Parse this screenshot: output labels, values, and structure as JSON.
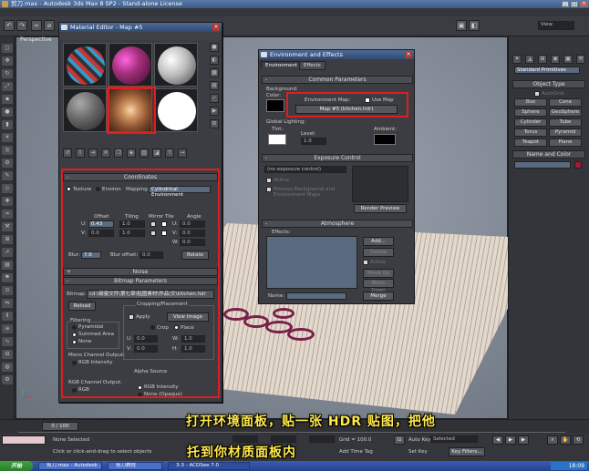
{
  "window": {
    "title": "剪刀.max - Autodesk 3ds Max 8 SP2 - Stand-alone License",
    "view_dropdown": "View"
  },
  "viewport": {
    "label": "Perspective"
  },
  "material_editor": {
    "title": "Material Editor - Map #5",
    "coordinates_rollup": {
      "title": "Coordinates",
      "texture_label": "Texture",
      "environ_label": "Environ",
      "mapping_label": "Mapping:",
      "mapping_value": "Cylindrical Environment",
      "offset_label": "Offset",
      "tiling_label": "Tiling",
      "mirror_tile_label": "Mirror Tile",
      "angle_label": "Angle",
      "u_label": "U:",
      "v_label": "V:",
      "w_label": "W:",
      "u_offset": "0.43",
      "u_tiling": "1.0",
      "u_angle": "0.0",
      "v_offset": "0.0",
      "v_tiling": "1.0",
      "v_angle": "0.0",
      "w_angle": "0.0",
      "blur_label": "Blur:",
      "blur_value": "7.0",
      "blur_offset_label": "Blur offset:",
      "blur_offset_value": "0.0",
      "rotate_label": "Rotate"
    },
    "noise_rollup": {
      "title": "Noise"
    },
    "bitmap_rollup": {
      "title": "Bitmap Parameters",
      "bitmap_label": "Bitmap:",
      "bitmap_path": "cd:\\碳曼文件\\第七章\\贴图素材\\作品\\文\\kitchen.hdr",
      "reload_label": "Reload",
      "cropping_title": "Cropping/Placement",
      "apply_label": "Apply",
      "view_image_label": "View Image",
      "crop_label": "Crop",
      "place_label": "Place",
      "u_label": "U:",
      "v_label": "V:",
      "w_label": "W:",
      "h_label": "H:",
      "u_value": "0.0",
      "v_value": "0.0",
      "w_value": "1.0",
      "h_value": "1.0",
      "filtering_title": "Filtering",
      "filter_pyramidal": "Pyramidal",
      "filter_summed": "Summed Area",
      "filter_none": "None",
      "mono_title": "Mono Channel Output:",
      "mono_rgb": "RGB Intensity",
      "rgb_title": "RGB Channel Output:",
      "rgb_rgb": "RGB",
      "alpha_title": "Alpha Source",
      "alpha_rgb": "RGB Intensity",
      "alpha_none": "None (Opaque)"
    }
  },
  "env_effects": {
    "title": "Environment and Effects",
    "tabs": [
      "Environment",
      "Effects"
    ],
    "common_rollup": "Common Parameters",
    "background_label": "Background:",
    "color_label": "Color:",
    "env_map_label": "Environment Map:",
    "use_map_label": "Use Map",
    "map_button": "Map #5 (kitchen.hdr)",
    "global_lighting_label": "Global Lighting:",
    "tint_label": "Tint:",
    "level_label": "Level:",
    "level_value": "1.0",
    "ambient_label": "Ambient:",
    "exposure_rollup": "Exposure Control",
    "exposure_value": "(no exposure control)",
    "active_label": "Active",
    "process_bg_label": "Process Background and Environment Maps",
    "render_preview_label": "Render Preview",
    "atmosphere_rollup": "Atmosphere",
    "effects_label": "Effects:",
    "add_label": "Add...",
    "delete_label": "Delete",
    "active2_label": "Active",
    "move_up_label": "Move Up",
    "move_down_label": "Move Down",
    "name_label": "Name:",
    "merge_label": "Merge"
  },
  "command_panel": {
    "dropdown": "Standard Primitives",
    "object_type_title": "Object Type",
    "autogrid_label": "AutoGrid",
    "buttons": [
      "Box",
      "Cone",
      "Sphere",
      "GeoSphere",
      "Cylinder",
      "Tube",
      "Torus",
      "Pyramid",
      "Teapot",
      "Plane"
    ],
    "name_color_title": "Name and Color"
  },
  "timeline": {
    "frame_label": "0 / 100"
  },
  "status": {
    "selection": "None Selected",
    "prompt": "Click or click-and-drag to select objects",
    "grid": "Grid = 100.0",
    "add_time_tag": "Add Time Tag",
    "x_value": "",
    "auto_key": "Auto Key",
    "set_key": "Set Key",
    "selected_label": "Selected",
    "key_filters": "Key Filters..."
  },
  "taskbar": {
    "start": "开始",
    "tasks": [
      "剪刀.max - Autodesk ...",
      "剪刀教程",
      "3-3 - ACDSee 7.0"
    ],
    "clock": "18:09"
  },
  "subtitles": [
    "打开环境面板，贴一张 HDR 贴图，把他",
    "托到你材质面板内"
  ],
  "colors": {
    "highlight": "#e11d1d",
    "subtitle": "#ffe94a",
    "title_bar": "#3d5b88"
  }
}
